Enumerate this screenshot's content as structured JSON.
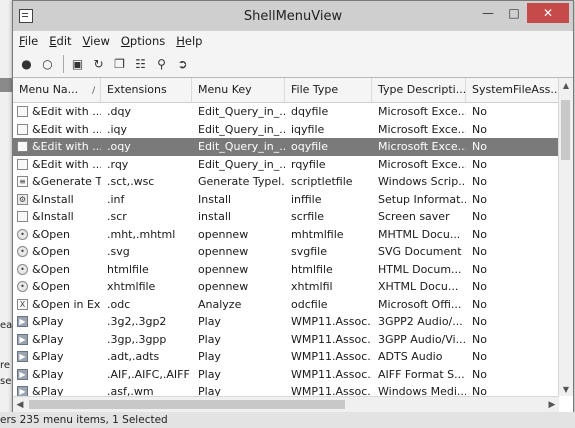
{
  "window": {
    "title": "ShellMenuView"
  },
  "menubar": [
    {
      "label": "File",
      "underline": "F",
      "rest": "ile"
    },
    {
      "label": "Edit",
      "underline": "E",
      "rest": "dit"
    },
    {
      "label": "View",
      "underline": "V",
      "rest": "iew"
    },
    {
      "label": "Options",
      "underline": "O",
      "rest": "ptions"
    },
    {
      "label": "Help",
      "underline": "H",
      "rest": "elp"
    }
  ],
  "toolbar": {
    "icons": [
      "enable-icon",
      "disable-icon",
      "save-icon",
      "refresh-icon",
      "copy-icon",
      "properties-icon",
      "find-icon",
      "exit-icon"
    ]
  },
  "columns": [
    "Menu Na...",
    "Extensions",
    "Menu Key",
    "File Type",
    "Type Descripti...",
    "SystemFileAss..."
  ],
  "sort_indicator": "/",
  "rows": [
    {
      "icon": "doc-icon",
      "name": "&Edit with ...",
      "ext": ".dqy",
      "key": "Edit_Query_in_...",
      "ftype": "dqyfile",
      "desc": "Microsoft Exce...",
      "sys": "No",
      "selected": false
    },
    {
      "icon": "doc-icon",
      "name": "&Edit with ...",
      "ext": ".iqy",
      "key": "Edit_Query_in_...",
      "ftype": "iqyfile",
      "desc": "Microsoft Exce...",
      "sys": "No",
      "selected": false
    },
    {
      "icon": "doc-icon",
      "name": "&Edit with ...",
      "ext": ".oqy",
      "key": "Edit_Query_in_...",
      "ftype": "oqyfile",
      "desc": "Microsoft Exce...",
      "sys": "No",
      "selected": true
    },
    {
      "icon": "doc-icon",
      "name": "&Edit with ...",
      "ext": ".rqy",
      "key": "Edit_Query_in_...",
      "ftype": "rqyfile",
      "desc": "Microsoft Exce...",
      "sys": "No",
      "selected": false
    },
    {
      "icon": "script-icon",
      "name": "&Generate T...",
      "ext": ".sct,.wsc",
      "key": "Generate Typel...",
      "ftype": "scriptletfile",
      "desc": "Windows Scrip...",
      "sys": "No",
      "selected": false
    },
    {
      "icon": "gear-icon",
      "name": "&Install",
      "ext": ".inf",
      "key": "Install",
      "ftype": "inffile",
      "desc": "Setup Informat...",
      "sys": "No",
      "selected": false
    },
    {
      "icon": "page-icon",
      "name": "&Install",
      "ext": ".scr",
      "key": "install",
      "ftype": "scrfile",
      "desc": "Screen saver",
      "sys": "No",
      "selected": false
    },
    {
      "icon": "globe-icon",
      "name": "&Open",
      "ext": ".mht,.mhtml",
      "key": "opennew",
      "ftype": "mhtmlfile",
      "desc": "MHTML Docu...",
      "sys": "No",
      "selected": false
    },
    {
      "icon": "globe-icon",
      "name": "&Open",
      "ext": ".svg",
      "key": "opennew",
      "ftype": "svgfile",
      "desc": "SVG Document",
      "sys": "No",
      "selected": false
    },
    {
      "icon": "globe-icon",
      "name": "&Open",
      "ext": "htmlfile",
      "key": "opennew",
      "ftype": "htmlfile",
      "desc": "HTML Docum...",
      "sys": "No",
      "selected": false
    },
    {
      "icon": "globe-icon",
      "name": "&Open",
      "ext": "xhtmlfile",
      "key": "opennew",
      "ftype": "xhtmlfil",
      "desc": "XHTML Docu...",
      "sys": "No",
      "selected": false
    },
    {
      "icon": "office-icon",
      "name": "&Open in Ex...",
      "ext": ".odc",
      "key": "Analyze",
      "ftype": "odcfile",
      "desc": "Microsoft Offi...",
      "sys": "No",
      "selected": false
    },
    {
      "icon": "play-icon",
      "name": "&Play",
      "ext": ".3g2,.3gp2",
      "key": "Play",
      "ftype": "WMP11.Assoc...",
      "desc": "3GPP2 Audio/...",
      "sys": "No",
      "selected": false
    },
    {
      "icon": "play-icon",
      "name": "&Play",
      "ext": ".3gp,.3gpp",
      "key": "Play",
      "ftype": "WMP11.Assoc...",
      "desc": "3GPP Audio/Vi...",
      "sys": "No",
      "selected": false
    },
    {
      "icon": "play-icon",
      "name": "&Play",
      "ext": ".adt,.adts",
      "key": "Play",
      "ftype": "WMP11.Assoc...",
      "desc": "ADTS Audio",
      "sys": "No",
      "selected": false
    },
    {
      "icon": "play-icon",
      "name": "&Play",
      "ext": ".AIF,.AIFC,.AIFF",
      "key": "Play",
      "ftype": "WMP11.Assoc...",
      "desc": "AIFF Format S...",
      "sys": "No",
      "selected": false
    },
    {
      "icon": "play-icon",
      "name": "&Play",
      "ext": ".asf,.wm",
      "key": "Play",
      "ftype": "WMP11.Assoc...",
      "desc": "Windows Medi...",
      "sys": "No",
      "selected": false
    }
  ],
  "statusbar": {
    "text": "ers 235 menu items, 1 Selected"
  },
  "background_fragments": [
    "ea",
    "re",
    "se"
  ],
  "colors": {
    "selection": "#7a7a7a",
    "close_button": "#c74a4a"
  }
}
